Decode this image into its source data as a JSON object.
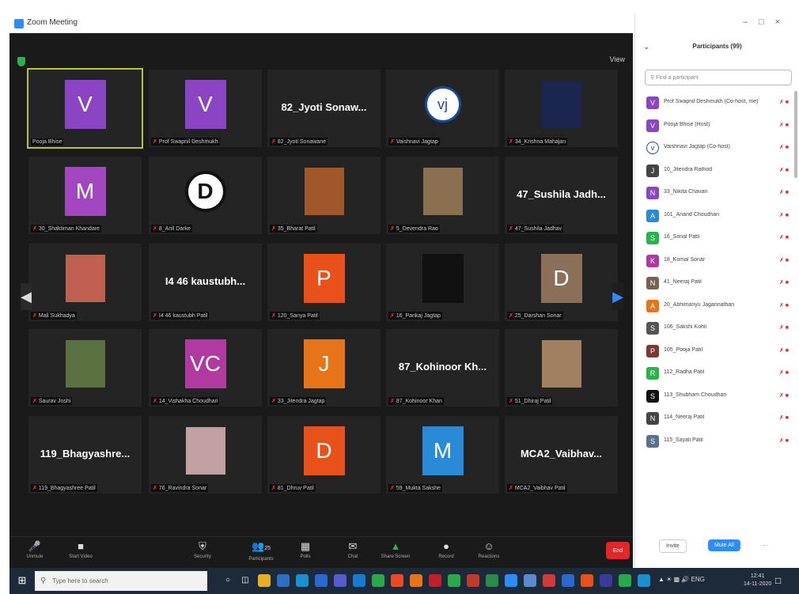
{
  "window": {
    "title": "Zoom Meeting",
    "view_label": "View"
  },
  "tiles": [
    {
      "name": "Pooja Bhise",
      "kind": "avatar",
      "initial": "V",
      "color": "#8a44c4",
      "active": true
    },
    {
      "name": "Prof Swapnil Deshmukh",
      "kind": "avatar",
      "initial": "V",
      "color": "#8a44c4"
    },
    {
      "name": "82_Jyoti Sonawane",
      "kind": "text",
      "display": "82_Jyoti  Sonaw..."
    },
    {
      "name": "Vaishnavi Jagtap",
      "kind": "logo",
      "initial": "vj",
      "color": "#ffffff"
    },
    {
      "name": "34_Krishna Mahajan",
      "kind": "photo",
      "color": "#1a2650"
    },
    {
      "name": "30_Shaktiman Khandare",
      "kind": "avatar",
      "initial": "M",
      "color": "#a347c0"
    },
    {
      "name": "8_Anil Darke",
      "kind": "circle",
      "initial": "D",
      "color": "#ffffff"
    },
    {
      "name": "35_Bharat Patil",
      "kind": "photo",
      "color": "#a0582a"
    },
    {
      "name": "5_Devendra Rao",
      "kind": "photo",
      "color": "#8a7050"
    },
    {
      "name": "47_Sushila Jadhav",
      "kind": "text",
      "display": "47_Sushila  Jadh..."
    },
    {
      "name": "Mali Sukhadya",
      "kind": "photo",
      "color": "#c06050"
    },
    {
      "name": "I4 46 kaustubh Patil",
      "kind": "text",
      "display": "I4 46 kaustubh..."
    },
    {
      "name": "120_Sanya Patil",
      "kind": "avatar",
      "initial": "P",
      "color": "#e8521a"
    },
    {
      "name": "16_Pankaj Jagtap",
      "kind": "blank",
      "color": "#111111"
    },
    {
      "name": "25_Darshan Sonar",
      "kind": "avatar",
      "initial": "D",
      "color": "#8c6f5a"
    },
    {
      "name": "Saurav Joshi",
      "kind": "photo",
      "color": "#5a7040"
    },
    {
      "name": "14_Vishakha Choudhari",
      "kind": "avatar",
      "initial": "VC",
      "color": "#b03aa0"
    },
    {
      "name": "33_Jitendra Jagtap",
      "kind": "avatar",
      "initial": "J",
      "color": "#e8741a"
    },
    {
      "name": "87_Kohinoor Khan",
      "kind": "text",
      "display": "87_Kohinoor  Kh..."
    },
    {
      "name": "51_Dhiraj Patil",
      "kind": "photo",
      "color": "#a08060"
    },
    {
      "name": "119_Bhagyashree Patil",
      "kind": "text",
      "display": "119_Bhagyashre..."
    },
    {
      "name": "76_Ravindra Sonar",
      "kind": "photo",
      "color": "#c0a0a0"
    },
    {
      "name": "81_Dhruv Patil",
      "kind": "avatar",
      "initial": "D",
      "color": "#e8521a"
    },
    {
      "name": "59_Mukta Sakshe",
      "kind": "avatar",
      "initial": "M",
      "color": "#2a8ad8"
    },
    {
      "name": "MCA2_Vaibhav Patil",
      "kind": "text",
      "display": "MCA2_Vaibhav..."
    }
  ],
  "toolbar": {
    "unmute": "Unmute",
    "start_video": "Start Video",
    "security": "Security",
    "participants": "Participants",
    "participants_count": "25",
    "polls": "Polls",
    "chat": "Chat",
    "share_screen": "Share Screen",
    "record": "Record",
    "reactions": "Reactions",
    "end": "End"
  },
  "panel": {
    "title": "Participants (99)",
    "search_placeholder": "Find a participant",
    "participants": [
      {
        "name": "Prof Swapnil Deshmukh (Co-host, me)",
        "initial": "V",
        "color": "#8a44c4"
      },
      {
        "name": "Pooja Bhise (Host)",
        "initial": "V",
        "color": "#8a44c4"
      },
      {
        "name": "Vaishnavi Jagtap (Co-host)",
        "initial": "v",
        "color": "#ffffff"
      },
      {
        "name": "10_Jitendra Rathod",
        "initial": "J",
        "color": "#444444"
      },
      {
        "name": "33_Nikita Chavan",
        "initial": "N",
        "color": "#8a44c4"
      },
      {
        "name": "101_Anand Choudhari",
        "initial": "A",
        "color": "#2a8ad8"
      },
      {
        "name": "16_Sonal Patil",
        "initial": "S",
        "color": "#29b34a"
      },
      {
        "name": "18_Komal Sonar",
        "initial": "K",
        "color": "#b03aa0"
      },
      {
        "name": "41_Neeraj Patil",
        "initial": "N",
        "color": "#7a6050"
      },
      {
        "name": "20_Abhimanyu Jagannathan",
        "initial": "A",
        "color": "#e8741a"
      },
      {
        "name": "106_Sakshi Kohli",
        "initial": "S",
        "color": "#555555"
      },
      {
        "name": "105_Pooja Patil",
        "initial": "P",
        "color": "#7a3a30"
      },
      {
        "name": "112_Radha Patil",
        "initial": "R",
        "color": "#29b34a"
      },
      {
        "name": "113_Shubham Choudhari",
        "initial": "S",
        "color": "#111111"
      },
      {
        "name": "114_Neeraj Patil",
        "initial": "N",
        "color": "#444444"
      },
      {
        "name": "115_Sayali Patil",
        "initial": "S",
        "color": "#5a7090"
      }
    ],
    "invite": "Invite",
    "mute_all": "Mute All",
    "more": "..."
  },
  "taskbar": {
    "search_placeholder": "Type here to search",
    "time": "12:41",
    "date": "14-11-2020",
    "tray_text": "ENG"
  }
}
